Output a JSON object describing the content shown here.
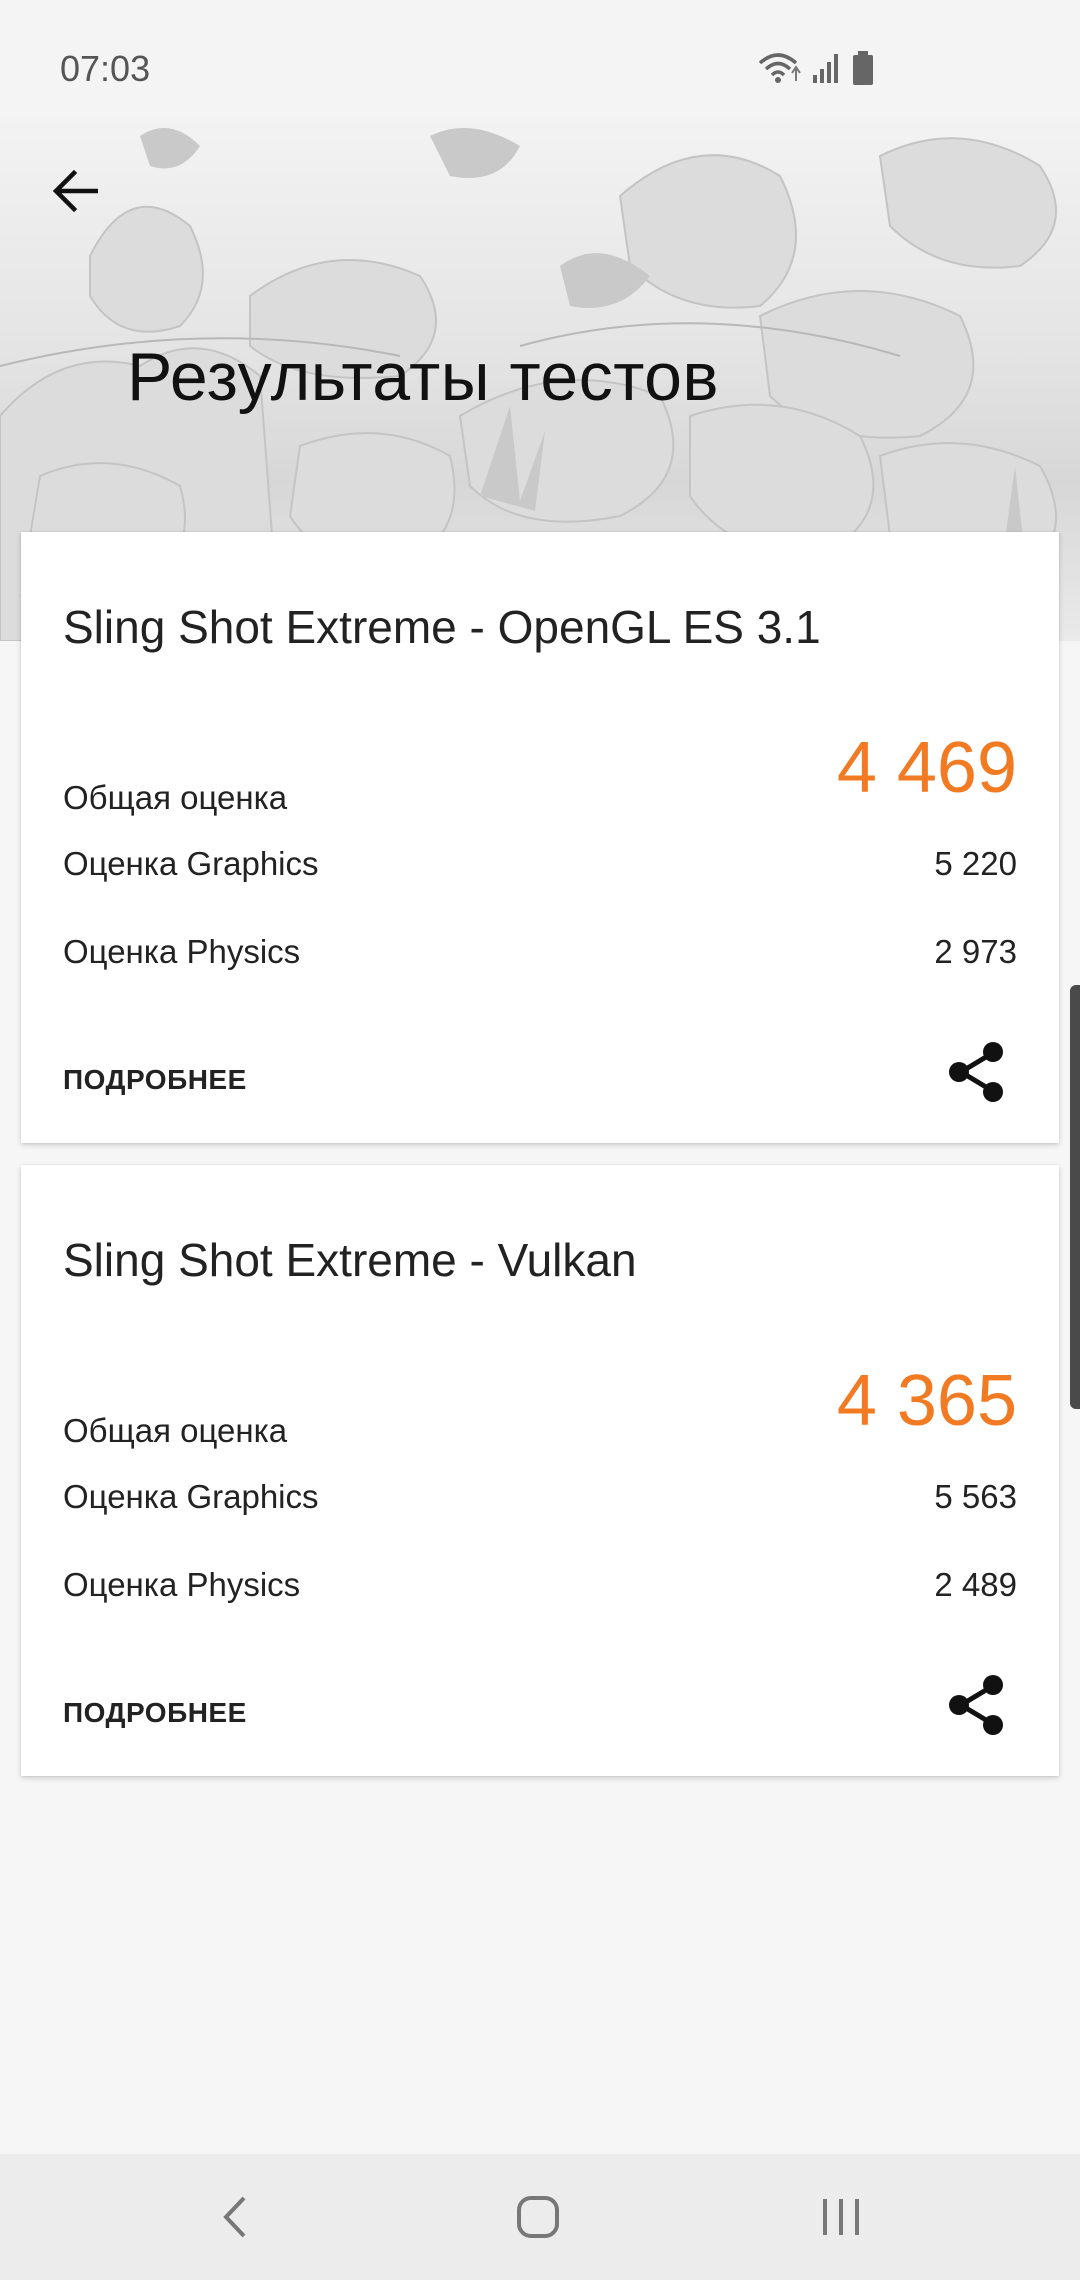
{
  "status_bar": {
    "time": "07:03",
    "icons": [
      "wifi-icon",
      "signal-icon",
      "battery-icon"
    ]
  },
  "header": {
    "title": "Результаты тестов",
    "back_icon": "arrow-left-icon"
  },
  "cards": [
    {
      "title": "Sling Shot Extreme - OpenGL ES 3.1",
      "overall_label": "Общая оценка",
      "overall_value": "4 469",
      "graphics_label": "Оценка Graphics",
      "graphics_value": "5 220",
      "physics_label": "Оценка Physics",
      "physics_value": "2 973",
      "details_label": "ПОДРОБНЕЕ",
      "share_icon": "share-icon"
    },
    {
      "title": "Sling Shot Extreme - Vulkan",
      "overall_label": "Общая оценка",
      "overall_value": "4 365",
      "graphics_label": "Оценка Graphics",
      "graphics_value": "5 563",
      "physics_label": "Оценка Physics",
      "physics_value": "2 489",
      "details_label": "ПОДРОБНЕЕ",
      "share_icon": "share-icon"
    }
  ],
  "nav_bar": {
    "buttons": [
      "nav-back-icon",
      "nav-home-icon",
      "nav-recent-icon"
    ]
  },
  "colors": {
    "accent": "#f17a23",
    "background": "#f6f6f6",
    "card": "#ffffff"
  }
}
